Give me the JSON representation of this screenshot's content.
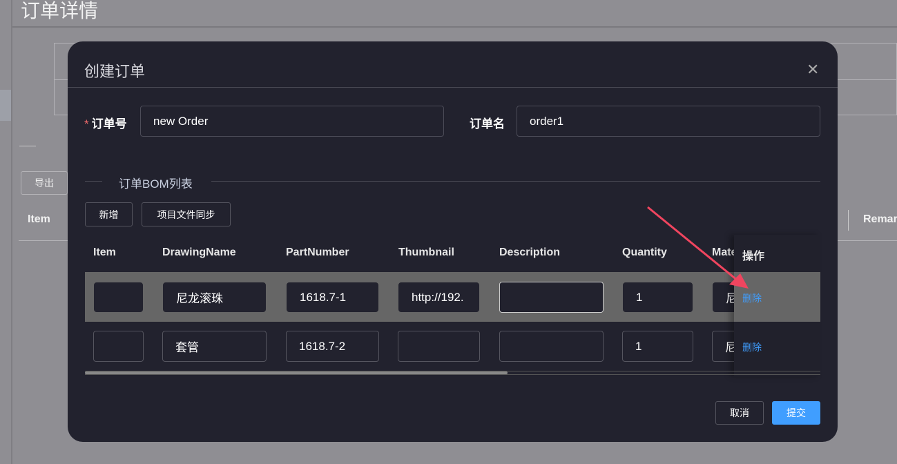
{
  "background": {
    "page_title": "订单详情",
    "export_button": "导出",
    "columns": [
      "Item",
      "Remar"
    ]
  },
  "dialog": {
    "title": "创建订单",
    "close_icon": "close-icon",
    "order_no_label": "订单号",
    "order_no_value": "new Order",
    "order_name_label": "订单名",
    "order_name_value": "order1",
    "bom_section_title": "订单BOM列表",
    "add_button": "新增",
    "sync_button": "项目文件同步",
    "table": {
      "columns": [
        "Item",
        "DrawingName",
        "PartNumber",
        "Thumbnail",
        "Description",
        "Quantity",
        "Mate",
        "操作"
      ],
      "rows": [
        {
          "item": "",
          "drawing_name": "尼龙滚珠",
          "part_number": "1618.7-1",
          "thumbnail": "http://192.",
          "description": "",
          "quantity": "1",
          "material": "尼",
          "action": "删除"
        },
        {
          "item": "",
          "drawing_name": "套管",
          "part_number": "1618.7-2",
          "thumbnail": "",
          "description": "",
          "quantity": "1",
          "material": "尼",
          "action": "删除"
        }
      ]
    },
    "cancel_button": "取消",
    "submit_button": "提交",
    "accent_color": "#409eff",
    "annotation_arrow_color": "#f0455f"
  }
}
